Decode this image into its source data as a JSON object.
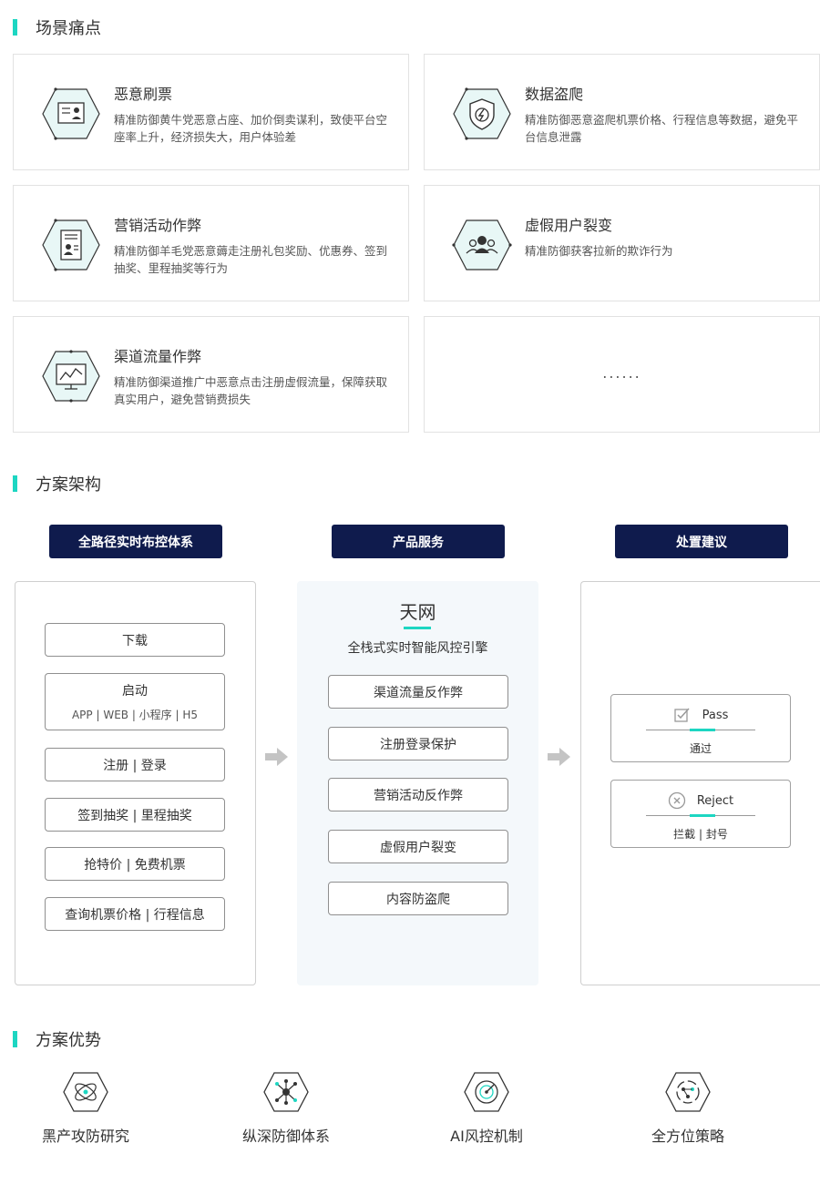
{
  "sections": {
    "pain_title": "场景痛点",
    "arch_title": "方案架构",
    "adv_title": "方案优势"
  },
  "pain_points": [
    {
      "icon": "ticket-hoarding-icon",
      "title": "恶意刷票",
      "desc": "精准防御黄牛党恶意占座、加价倒卖谋利，致使平台空座率上升，经济损失大，用户体验差"
    },
    {
      "icon": "data-scraping-icon",
      "title": "数据盗爬",
      "desc": "精准防御恶意盗爬机票价格、行程信息等数据，避免平台信息泄露"
    },
    {
      "icon": "marketing-fraud-icon",
      "title": "营销活动作弊",
      "desc": "精准防御羊毛党恶意薅走注册礼包奖励、优惠券、签到抽奖、里程抽奖等行为"
    },
    {
      "icon": "fake-user-icon",
      "title": "虚假用户裂变",
      "desc": "精准防御获客拉新的欺诈行为"
    },
    {
      "icon": "channel-traffic-icon",
      "title": "渠道流量作弊",
      "desc": "精准防御渠道推广中恶意点击注册虚假流量，保障获取真实用户，避免营销费损失"
    }
  ],
  "more_placeholder": "......",
  "architecture": {
    "col1_header": "全路径实时布控体系",
    "col2_header": "产品服务",
    "col3_header": "处置建议",
    "col1_items": [
      {
        "label": "下载",
        "sub": ""
      },
      {
        "label": "启动",
        "sub": "APP | WEB | 小程序 | H5"
      },
      {
        "label": "注册 | 登录",
        "sub": ""
      },
      {
        "label": "签到抽奖 | 里程抽奖",
        "sub": ""
      },
      {
        "label": "抢特价 | 免费机票",
        "sub": ""
      },
      {
        "label": "查询机票价格 | 行程信息",
        "sub": ""
      }
    ],
    "product_name": "天网",
    "product_desc": "全栈式实时智能风控引擎",
    "product_items": [
      "渠道流量反作弊",
      "注册登录保护",
      "营销活动反作弊",
      "虚假用户裂变",
      "内容防盗爬"
    ],
    "results": [
      {
        "icon": "check-icon",
        "en": "Pass",
        "cn": "通过"
      },
      {
        "icon": "x-circle-icon",
        "en": "Reject",
        "cn": "拦截 | 封号"
      }
    ]
  },
  "advantages": [
    {
      "icon": "research-icon",
      "label": "黑产攻防研究"
    },
    {
      "icon": "network-icon",
      "label": "纵深防御体系"
    },
    {
      "icon": "ai-radar-icon",
      "label": "AI风控机制"
    },
    {
      "icon": "strategy-icon",
      "label": "全方位策略"
    }
  ],
  "colors": {
    "accent": "#1dd6c2",
    "navy": "#0f1b4d",
    "icon_bg": "#e6f7f7"
  }
}
